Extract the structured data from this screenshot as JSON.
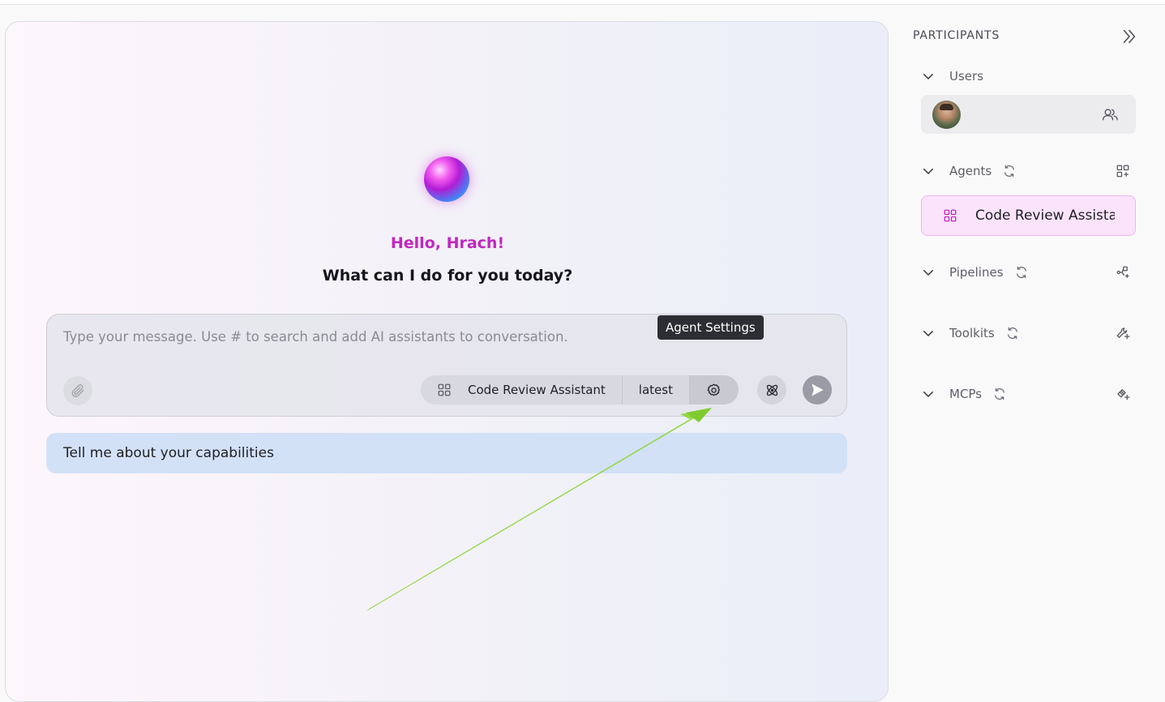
{
  "greeting": "Hello, Hrach!",
  "subtitle": "What can I do for you today?",
  "composer": {
    "placeholder": "Type your message. Use # to search and add AI assistants to conversation.",
    "agent_name": "Code Review Assistant",
    "agent_version": "latest",
    "tooltip": "Agent Settings"
  },
  "suggestion": "Tell me about your capabilities",
  "sidebar": {
    "title": "PARTICIPANTS",
    "sections": {
      "users": "Users",
      "agents": "Agents",
      "pipelines": "Pipelines",
      "toolkits": "Toolkits",
      "mcps": "MCPs"
    },
    "agent_item": "Code Review Assistant"
  },
  "colors": {
    "greeting": "#c227c0",
    "suggestion_bg": "#d3e1f6",
    "agent_card_bg": "#fbe3fb",
    "annotation_arrow": "#8ed63c"
  }
}
